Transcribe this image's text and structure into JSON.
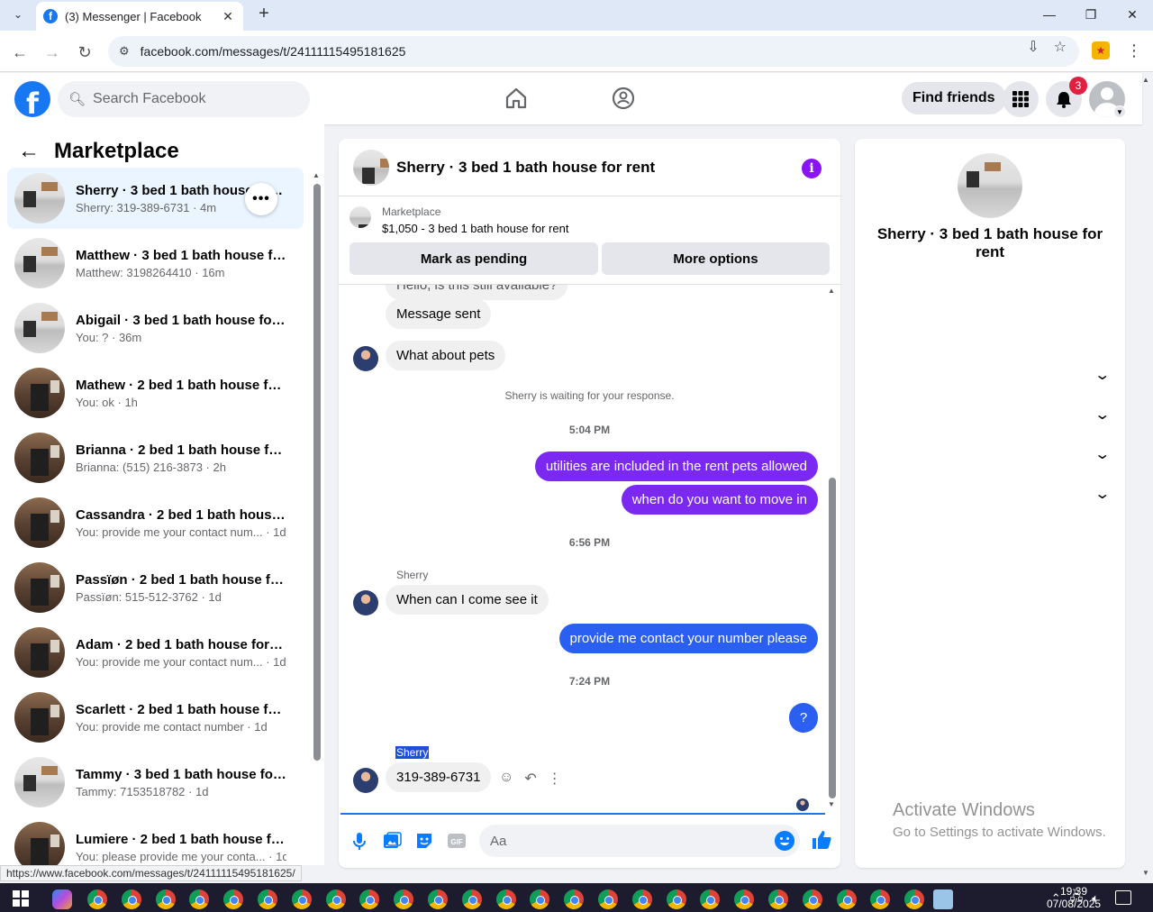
{
  "browser": {
    "tab_title": "(3) Messenger | Facebook",
    "url": "facebook.com/messages/t/24111115495181625",
    "status_url": "https://www.facebook.com/messages/t/24111115495181625/"
  },
  "fb_header": {
    "search_placeholder": "Search Facebook",
    "find_friends_label": "Find friends",
    "notification_count": "3"
  },
  "sidebar": {
    "title": "Marketplace",
    "conversations": [
      {
        "name": "Sherry · 3 bed 1 bath house for rent",
        "preview": "Sherry: 319-389-6731 · 4m",
        "thumb": "light",
        "active": true
      },
      {
        "name": "Matthew · 3 bed 1 bath house fo...",
        "preview": "Matthew: 3198264410 · 16m",
        "thumb": "light"
      },
      {
        "name": "Abigail · 3 bed 1 bath house for ...",
        "preview": "You: ? · 36m",
        "thumb": "light"
      },
      {
        "name": "Mathew · 2 bed 1 bath house for...",
        "preview": "You: ok · 1h",
        "thumb": "dark"
      },
      {
        "name": "Brianna · 2 bed 1 bath house for ...",
        "preview": "Brianna: (515) 216-3873 · 2h",
        "thumb": "dark"
      },
      {
        "name": "Cassandra · 2 bed 1 bath house f...",
        "preview": "You: provide me your contact num... · 1d",
        "thumb": "dark"
      },
      {
        "name": "Passïøn · 2 bed 1 bath house for ...",
        "preview": "Passïøn: 515-512-3762 · 1d",
        "thumb": "dark"
      },
      {
        "name": "Adam · 2 bed 1 bath house for r...",
        "preview": "You: provide me your contact num... · 1d",
        "thumb": "dark"
      },
      {
        "name": "Scarlett · 2 bed 1 bath house for ...",
        "preview": "You: provide me contact number · 1d",
        "thumb": "dark"
      },
      {
        "name": "Tammy · 3 bed 1 bath house for ...",
        "preview": "Tammy: 7153518782 · 1d",
        "thumb": "light"
      },
      {
        "name": "Lumiere · 2 bed 1 bath house for...",
        "preview": "You: please provide me your conta... · 1d",
        "thumb": "dark"
      }
    ]
  },
  "chat": {
    "title": "Sherry · 3 bed 1 bath house for rent",
    "marketplace_label": "Marketplace",
    "listing": "$1,050 - 3 bed 1 bath house for rent",
    "mark_pending_label": "Mark as pending",
    "more_options_label": "More options",
    "partial_message": "Hello, is this still available?",
    "msg_sent": "Message sent",
    "msg_pets": "What about pets",
    "waiting_notice": "Sherry is waiting for your response.",
    "time_1": "5:04 PM",
    "msg_utilities": "utilities are included in the rent pets allowed",
    "msg_move_in": "when do you want to move in",
    "time_2": "6:56 PM",
    "sender_1": "Sherry",
    "msg_come_see": "When can I come see it",
    "msg_contact": "provide me contact your number please",
    "time_3": "7:24 PM",
    "msg_question": "?",
    "sender_2": "Sherry",
    "msg_phone": "319-389-6731",
    "composer_placeholder": "Aa"
  },
  "details_panel": {
    "title": "Sherry · 3 bed 1 bath house for rent"
  },
  "watermark": {
    "line1": "Activate Windows",
    "line2": "Go to Settings to activate Windows."
  },
  "taskbar": {
    "time": "19:39",
    "date": "07/08/2025"
  },
  "colors": {
    "brand": "#1877f2",
    "outgoing_bubble": "#7a28f2",
    "outgoing_bubble_alt": "#2b5ff2",
    "incoming_bubble": "#f0f0f0",
    "info_icon": "#8a14f5"
  }
}
